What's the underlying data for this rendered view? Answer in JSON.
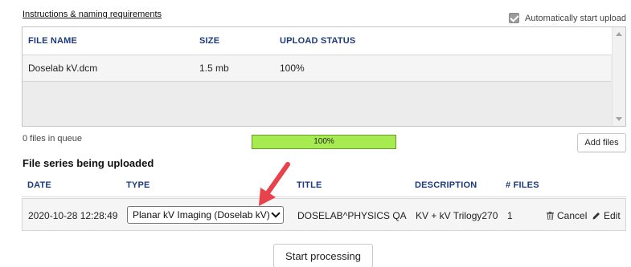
{
  "instructions_link": "Instructions & naming requirements",
  "auto_start": {
    "label": "Automatically start upload",
    "checked": true
  },
  "file_table": {
    "columns": [
      "FILE NAME",
      "SIZE",
      "UPLOAD STATUS"
    ],
    "rows": [
      {
        "name": "Doselab kV.dcm",
        "size": "1.5 mb",
        "status": "100%"
      }
    ]
  },
  "queue_info": "0 files in queue",
  "progress": {
    "label": "100%",
    "value": 100
  },
  "add_files_label": "Add files",
  "series_section_title": "File series being uploaded",
  "series_table": {
    "columns": [
      "DATE",
      "TYPE",
      "TITLE",
      "DESCRIPTION",
      "# FILES"
    ],
    "rows": [
      {
        "date": "2020-10-28 12:28:49",
        "type": "Planar kV Imaging (Doselab kV)",
        "title": "DOSELAB^PHYSICS QA",
        "description": "KV + kV Trilogy270",
        "files": "1",
        "cancel_label": "Cancel",
        "edit_label": "Edit"
      }
    ]
  },
  "start_processing_label": "Start processing",
  "colors": {
    "header_text": "#1d3b7a",
    "progress_fill": "#a6ec51",
    "arrow": "#e8424a"
  }
}
